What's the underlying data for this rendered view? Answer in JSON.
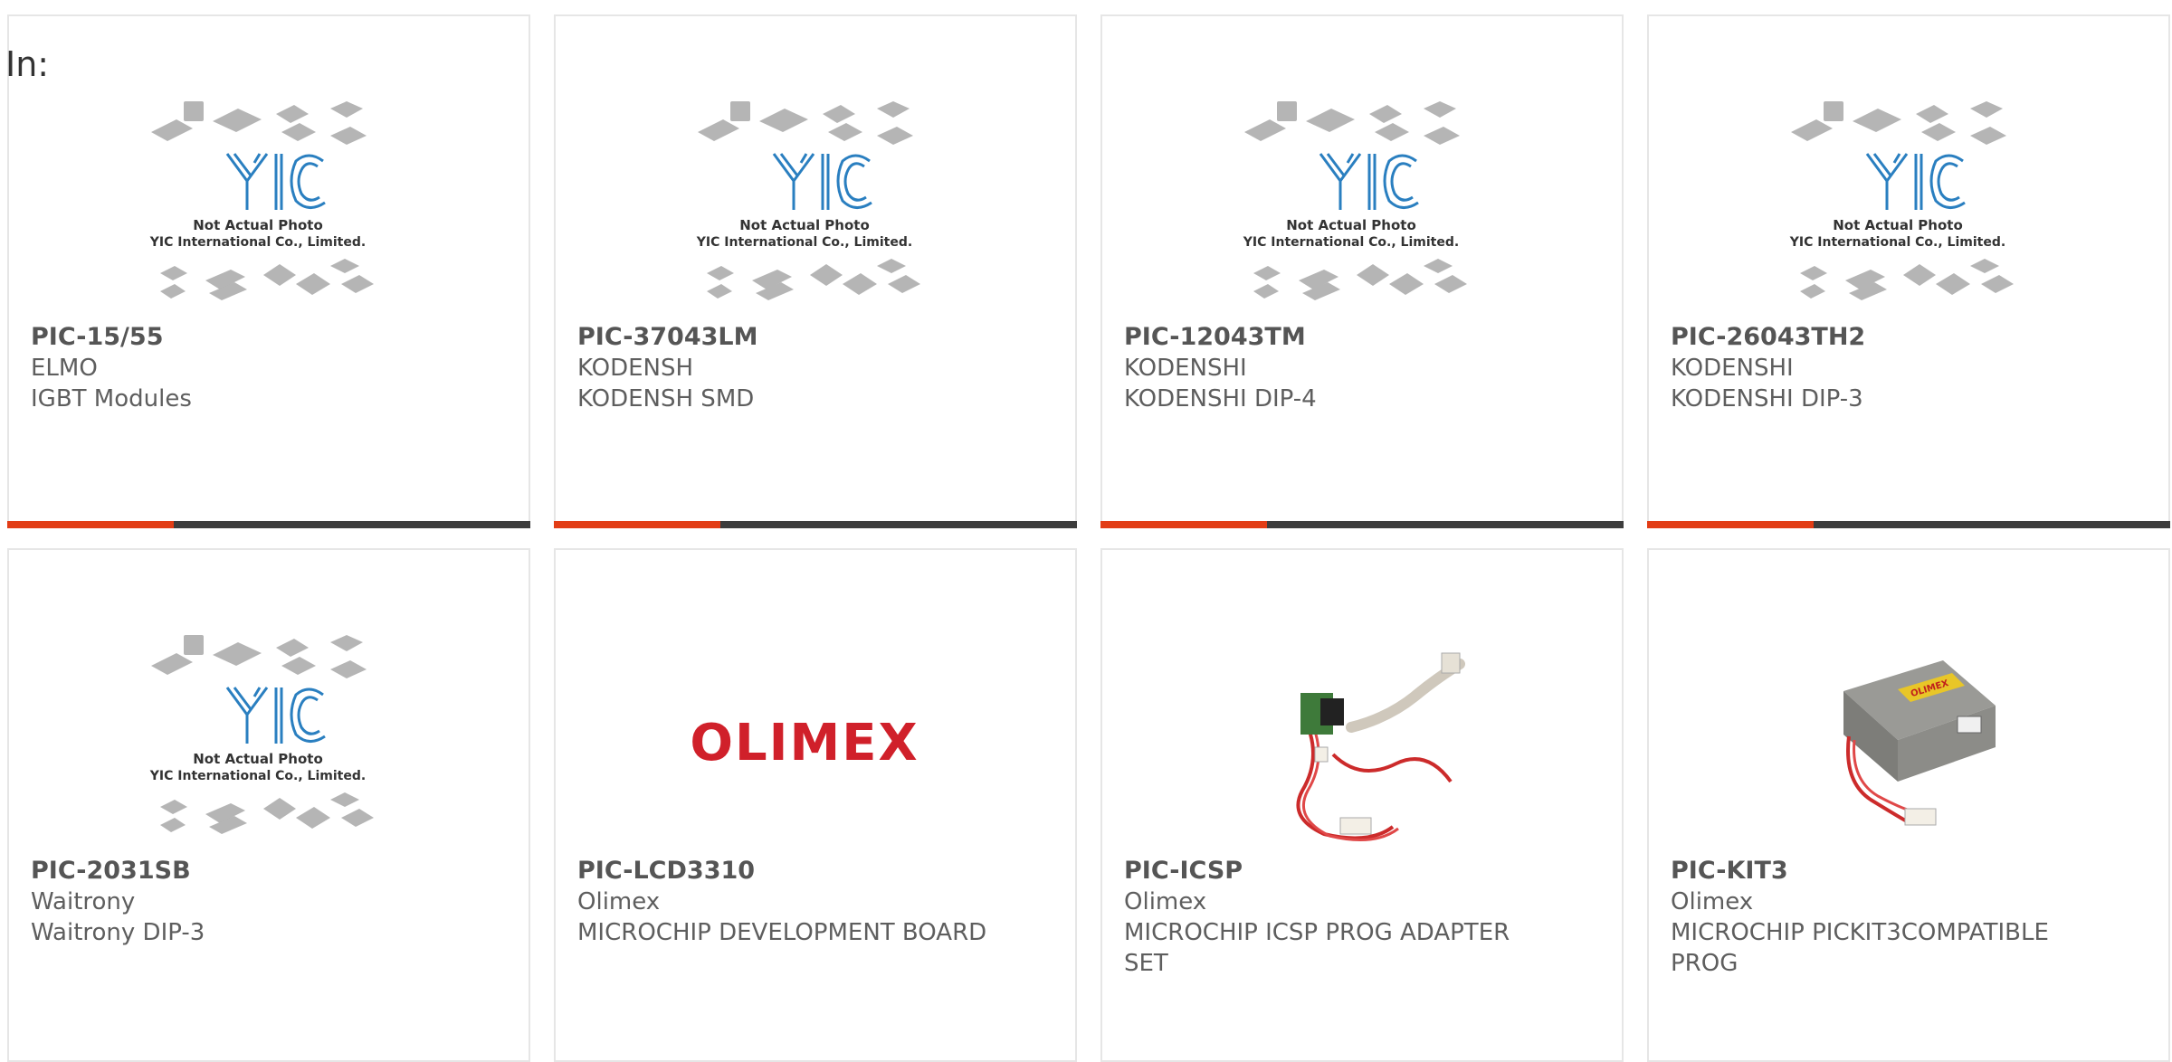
{
  "header": {
    "label": "In:"
  },
  "placeholder_image": {
    "line1": "Not Actual Photo",
    "line2": "YIC International Co., Limited."
  },
  "olimex_logo_text": "OLIMEX",
  "products": [
    {
      "part": "PIC-15/55",
      "manufacturer": "ELMO",
      "description": "IGBT Modules",
      "image": "yic-placeholder"
    },
    {
      "part": "PIC-37043LM",
      "manufacturer": "KODENSH",
      "description": "KODENSH SMD",
      "image": "yic-placeholder"
    },
    {
      "part": "PIC-12043TM",
      "manufacturer": "KODENSHI",
      "description": "KODENSHI DIP-4",
      "image": "yic-placeholder"
    },
    {
      "part": "PIC-26043TH2",
      "manufacturer": "KODENSHI",
      "description": "KODENSHI DIP-3",
      "image": "yic-placeholder"
    },
    {
      "part": "PIC-2031SB",
      "manufacturer": "Waitrony",
      "description": "Waitrony DIP-3",
      "image": "yic-placeholder"
    },
    {
      "part": "PIC-LCD3310",
      "manufacturer": "Olimex",
      "description": "MICROCHIP DEVELOPMENT BOARD",
      "image": "olimex-logo"
    },
    {
      "part": "PIC-ICSP",
      "manufacturer": "Olimex",
      "description": "MICROCHIP ICSP PROG ADAPTER SET",
      "image": "cable-adapter-photo"
    },
    {
      "part": "PIC-KIT3",
      "manufacturer": "Olimex",
      "description": "MICROCHIP PICKIT3COMPATIBLE PROG",
      "image": "programmer-photo"
    }
  ],
  "colors": {
    "accent": "#e23d16",
    "bar_dark": "#3d3d3d",
    "logo_blue": "#2a7fc0",
    "olimex_red": "#d0202a"
  }
}
